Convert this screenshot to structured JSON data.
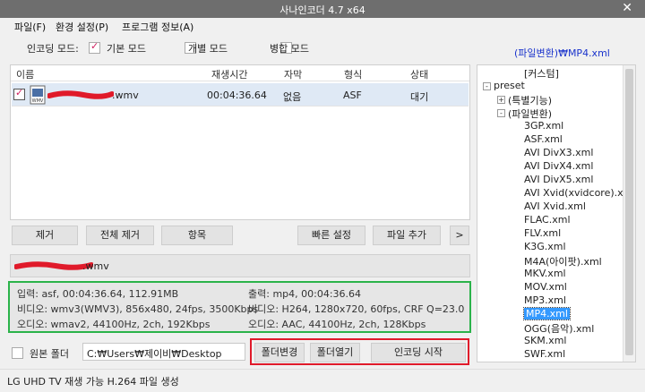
{
  "window": {
    "title": "사나인코더 4.7 x64",
    "close_glyph": "✕"
  },
  "menu": [
    "파일(F)",
    "환경 설정(P)",
    "프로그램 정보(A)"
  ],
  "encoding_mode": {
    "label": "인코딩 모드:",
    "options": [
      {
        "label": "기본 모드",
        "checked": true
      },
      {
        "label": "개별 모드",
        "checked": false
      },
      {
        "label": "병합 모드",
        "checked": false
      }
    ],
    "current_preset": "(파일변환)₩MP4.xml"
  },
  "file_list": {
    "columns": [
      "이름",
      "재생시간",
      "자막",
      "형식",
      "상태"
    ],
    "rows": [
      {
        "checked": true,
        "icon": "wmv-file-icon",
        "name": ".wmv",
        "duration": "00:04:36.64",
        "subtitle": "없음",
        "format": "ASF",
        "status": "대기"
      }
    ]
  },
  "list_buttons": [
    "제거",
    "전체 제거",
    "항목",
    "빠른 설정",
    "파일 추가",
    ">"
  ],
  "selected_file": {
    "name": ".wmv"
  },
  "info": {
    "input": "입력: asf, 00:04:36.64, 112.91MB",
    "input_video": "비디오: wmv3(WMV3), 856x480, 24fps, 3500Kbps",
    "input_audio": "오디오: wmav2, 44100Hz, 2ch, 192Kbps",
    "output": "출력: mp4, 00:04:36.64",
    "output_video": "비디오: H264, 1280x720, 60fps, CRF Q=23.0",
    "output_audio": "오디오: AAC, 44100Hz, 2ch, 128Kbps"
  },
  "bottom": {
    "original_folder_label": "원본 폴더",
    "original_folder_checked": false,
    "output_path": "C:₩Users₩제이비₩Desktop",
    "change_folder": "폴더변경",
    "open_folder": "폴더열기",
    "start_encoding": "인코딩 시작"
  },
  "tree": {
    "items": [
      {
        "label": "[커스텀]",
        "depth": 2
      },
      {
        "label": "preset",
        "depth": 0,
        "toggle": "-"
      },
      {
        "label": "(특별기능)",
        "depth": 1,
        "toggle": "+"
      },
      {
        "label": "(파일변환)",
        "depth": 1,
        "toggle": "-"
      },
      {
        "label": "3GP.xml",
        "depth": 2
      },
      {
        "label": "ASF.xml",
        "depth": 2
      },
      {
        "label": "AVI DivX3.xml",
        "depth": 2
      },
      {
        "label": "AVI DivX4.xml",
        "depth": 2
      },
      {
        "label": "AVI DivX5.xml",
        "depth": 2
      },
      {
        "label": "AVI Xvid(xvidcore).xml",
        "depth": 2
      },
      {
        "label": "AVI Xvid.xml",
        "depth": 2
      },
      {
        "label": "FLAC.xml",
        "depth": 2
      },
      {
        "label": "FLV.xml",
        "depth": 2
      },
      {
        "label": "K3G.xml",
        "depth": 2
      },
      {
        "label": "M4A(아이팟).xml",
        "depth": 2
      },
      {
        "label": "MKV.xml",
        "depth": 2
      },
      {
        "label": "MOV.xml",
        "depth": 2
      },
      {
        "label": "MP3.xml",
        "depth": 2
      },
      {
        "label": "MP4.xml",
        "depth": 2,
        "selected": true
      },
      {
        "label": "OGG(음악).xml",
        "depth": 2
      },
      {
        "label": "SKM.xml",
        "depth": 2
      },
      {
        "label": "SWF.xml",
        "depth": 2
      }
    ]
  },
  "status": "LG UHD TV 재생 가능 H.264 파일 생성",
  "colors": {
    "accent_checkmark": "#d02060",
    "preset_link": "#1a33cc",
    "selection": "#3399ff",
    "redact": "#e01a2a",
    "green_box": "#2bb34a"
  }
}
